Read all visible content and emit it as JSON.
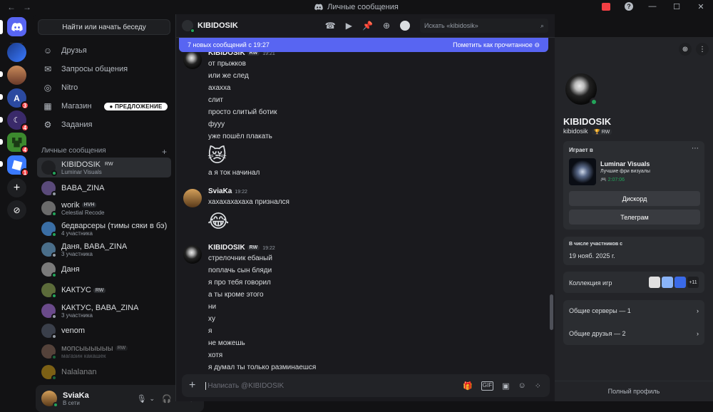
{
  "window": {
    "title": "Личные сообщения"
  },
  "servers": [
    {
      "badge": ""
    },
    {
      "badge": ""
    },
    {
      "badge": "3"
    },
    {
      "badge": "4"
    },
    {
      "badge": "4"
    },
    {
      "badge": "1"
    }
  ],
  "sidebar": {
    "search": "Найти или начать беседу",
    "nav": [
      "Друзья",
      "Запросы общения",
      "Nitro",
      "Магазин",
      "Задания"
    ],
    "offer_badge": "ПРЕДЛОЖЕНИЕ",
    "dm_header": "Личные сообщения",
    "dms": [
      {
        "name": "KIBIDOSIK",
        "tag": "RW",
        "sub": "Luminar Visuals",
        "color": "#1e1f22"
      },
      {
        "name": "BABA_ZINA",
        "tag": "",
        "sub": "",
        "color": "#5a4a7a"
      },
      {
        "name": "worik",
        "tag": "HVH",
        "sub": "Celestial Recode",
        "color": "#6b6b6b"
      },
      {
        "name": "бедварсеры (тимы сяки в бэ)",
        "tag": "",
        "sub": "4 участника",
        "color": "#3a6ea5"
      },
      {
        "name": "Даня, BABA_ZINA",
        "tag": "",
        "sub": "3 участника",
        "color": "#4a6e8a"
      },
      {
        "name": "Даня",
        "tag": "",
        "sub": "",
        "color": "#7a7a7a"
      },
      {
        "name": "КАКТУС",
        "tag": "RW",
        "sub": "",
        "color": "#5c6b3a"
      },
      {
        "name": "КАКТУС, BABA_ZINA",
        "tag": "",
        "sub": "3 участника",
        "color": "#6a4a8a"
      },
      {
        "name": "venom",
        "tag": "",
        "sub": "",
        "color": "#3a3f4a"
      },
      {
        "name": "мопсыыыыыы",
        "tag": "RW",
        "sub": "магазин какашек",
        "color": "#8a6a5a"
      },
      {
        "name": "Nalalanan",
        "tag": "",
        "sub": "",
        "color": "#d4a017"
      }
    ],
    "user": {
      "name": "SviaKa",
      "status": "В сети"
    }
  },
  "chat": {
    "channel": "KIBIDOSIK",
    "search_placeholder": "Искать «kibidosik»",
    "new_messages": "7 новых сообщений с 19:27",
    "mark_read": "Пометить как прочитанное",
    "composer_placeholder": "Написать @KIBIDOSIK",
    "groups": [
      {
        "author": "KIBIDOSIK",
        "tag": "RW",
        "time": "19:21",
        "avatar": "dark",
        "lines": [
          "от прыжков",
          "или же след",
          "ахахха",
          "слит",
          "просто слитый ботик",
          "фууу",
          "уже пошёл плакать",
          "😿",
          "а я ток начинал"
        ]
      },
      {
        "author": "SviaKa",
        "tag": "",
        "time": "19:22",
        "avatar": "light",
        "lines": [
          "хахахахахаха признался",
          "😂"
        ]
      },
      {
        "author": "KIBIDOSIK",
        "tag": "RW",
        "time": "19:22",
        "avatar": "dark",
        "lines": [
          "стрелочник ебаный",
          "поплачь сын бляди",
          "я про тебя говорил",
          "а ты кроме этого",
          "ни",
          "ху",
          "я",
          "не можешь",
          "хотя",
          "я думал ты только разминаешся"
        ]
      }
    ]
  },
  "profile": {
    "name": "KIBIDOSIK",
    "username": "kibidosik",
    "tag": "RW",
    "playing_label": "Играет в",
    "game": "Luminar Visuals",
    "game_sub": "Лучшие фри визуалы",
    "game_time": "2:07:06",
    "btn1": "Дискорд",
    "btn2": "Телеграм",
    "member_label": "В числе участников с",
    "member_date": "19 нояб. 2025 г.",
    "collection": "Коллекция игр",
    "collection_more": "+11",
    "mutual_servers": "Общие серверы — 1",
    "mutual_friends": "Общие друзья — 2",
    "full_profile": "Полный профиль"
  },
  "colors": {
    "accent": "#5865f2",
    "online": "#23a55a",
    "badge": "#f23f43"
  }
}
